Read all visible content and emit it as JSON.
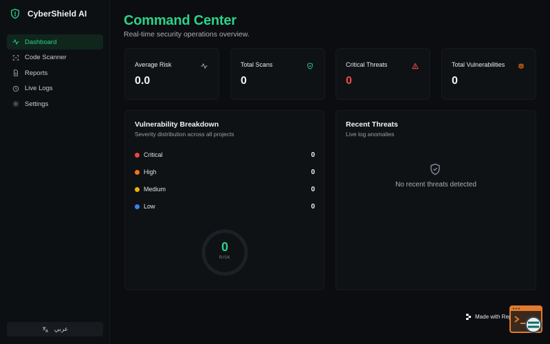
{
  "app": {
    "name": "CyberShield AI"
  },
  "sidebar": {
    "items": [
      {
        "label": "Dashboard",
        "icon": "activity-icon",
        "active": true
      },
      {
        "label": "Code Scanner",
        "icon": "scan-icon",
        "active": false
      },
      {
        "label": "Reports",
        "icon": "file-icon",
        "active": false
      },
      {
        "label": "Live Logs",
        "icon": "clock-icon",
        "active": false
      },
      {
        "label": "Settings",
        "icon": "gear-icon",
        "active": false
      }
    ],
    "language_button": "عربي"
  },
  "header": {
    "title": "Command Center",
    "subtitle": "Real-time security operations overview."
  },
  "stats": [
    {
      "label": "Average Risk",
      "value": "0.0",
      "icon": "activity-icon"
    },
    {
      "label": "Total Scans",
      "value": "0",
      "icon": "shield-check-icon"
    },
    {
      "label": "Critical Threats",
      "value": "0",
      "icon": "alert-triangle-icon"
    },
    {
      "label": "Total Vulnerabilities",
      "value": "0",
      "icon": "bug-icon"
    }
  ],
  "vulnerability_breakdown": {
    "title": "Vulnerability Breakdown",
    "subtitle": "Severity distribution across all projects",
    "severities": [
      {
        "name": "Critical",
        "count": "0",
        "color": "#ef4444"
      },
      {
        "name": "High",
        "count": "0",
        "color": "#f97316"
      },
      {
        "name": "Medium",
        "count": "0",
        "color": "#eab308"
      },
      {
        "name": "Low",
        "count": "0",
        "color": "#3b82f6"
      }
    ],
    "gauge": {
      "value": "0",
      "label": "RISK"
    }
  },
  "recent_threats": {
    "title": "Recent Threats",
    "subtitle": "Live log anomalies",
    "empty_message": "No recent threats detected"
  },
  "badge": {
    "text": "Made with Replit"
  },
  "colors": {
    "accent": "#2bd38a",
    "critical": "#f14c4c",
    "warning": "#f97316",
    "background": "#0b0d10"
  }
}
